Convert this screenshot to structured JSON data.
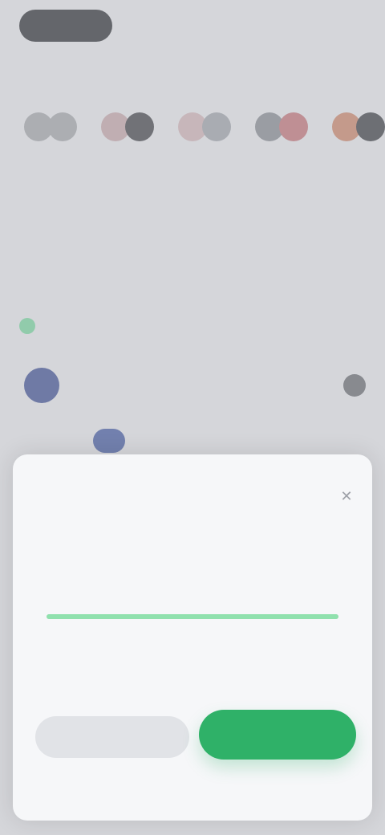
{
  "top": {
    "right_text": ""
  },
  "section": {
    "title": "",
    "more": ""
  },
  "avatars": [
    {
      "label": "",
      "c1": "#a8a9ad",
      "c2": "#a8a9ad"
    },
    {
      "label": "",
      "c1": "#c7a9ad",
      "c2": "#4d4e52"
    },
    {
      "label": "",
      "c1": "#d2b6b9",
      "c2": "#a3a6ad"
    },
    {
      "label": "",
      "c1": "#8d8f95",
      "c2": "#c57a7f"
    },
    {
      "label": "",
      "c1": "#cc8a70",
      "c2": "#47494e"
    }
  ],
  "stats": {
    "left": "",
    "right": ""
  },
  "tabs": [
    "",
    "",
    ""
  ],
  "row1": {
    "title": "",
    "right": ""
  },
  "row2": {
    "name": "",
    "tag": ""
  },
  "row3": {
    "text": "",
    "tag": ""
  },
  "sheet": {
    "title": "",
    "label_main": "",
    "label_sub": "",
    "slider": {
      "fill_fraction": 1.0,
      "accent": "#90e1ae"
    },
    "min_label": "",
    "max_label": "",
    "secondary_button": "",
    "primary_button": ""
  },
  "colors": {
    "primary": "#2fb168",
    "secondary_bg": "#e1e3e7"
  }
}
